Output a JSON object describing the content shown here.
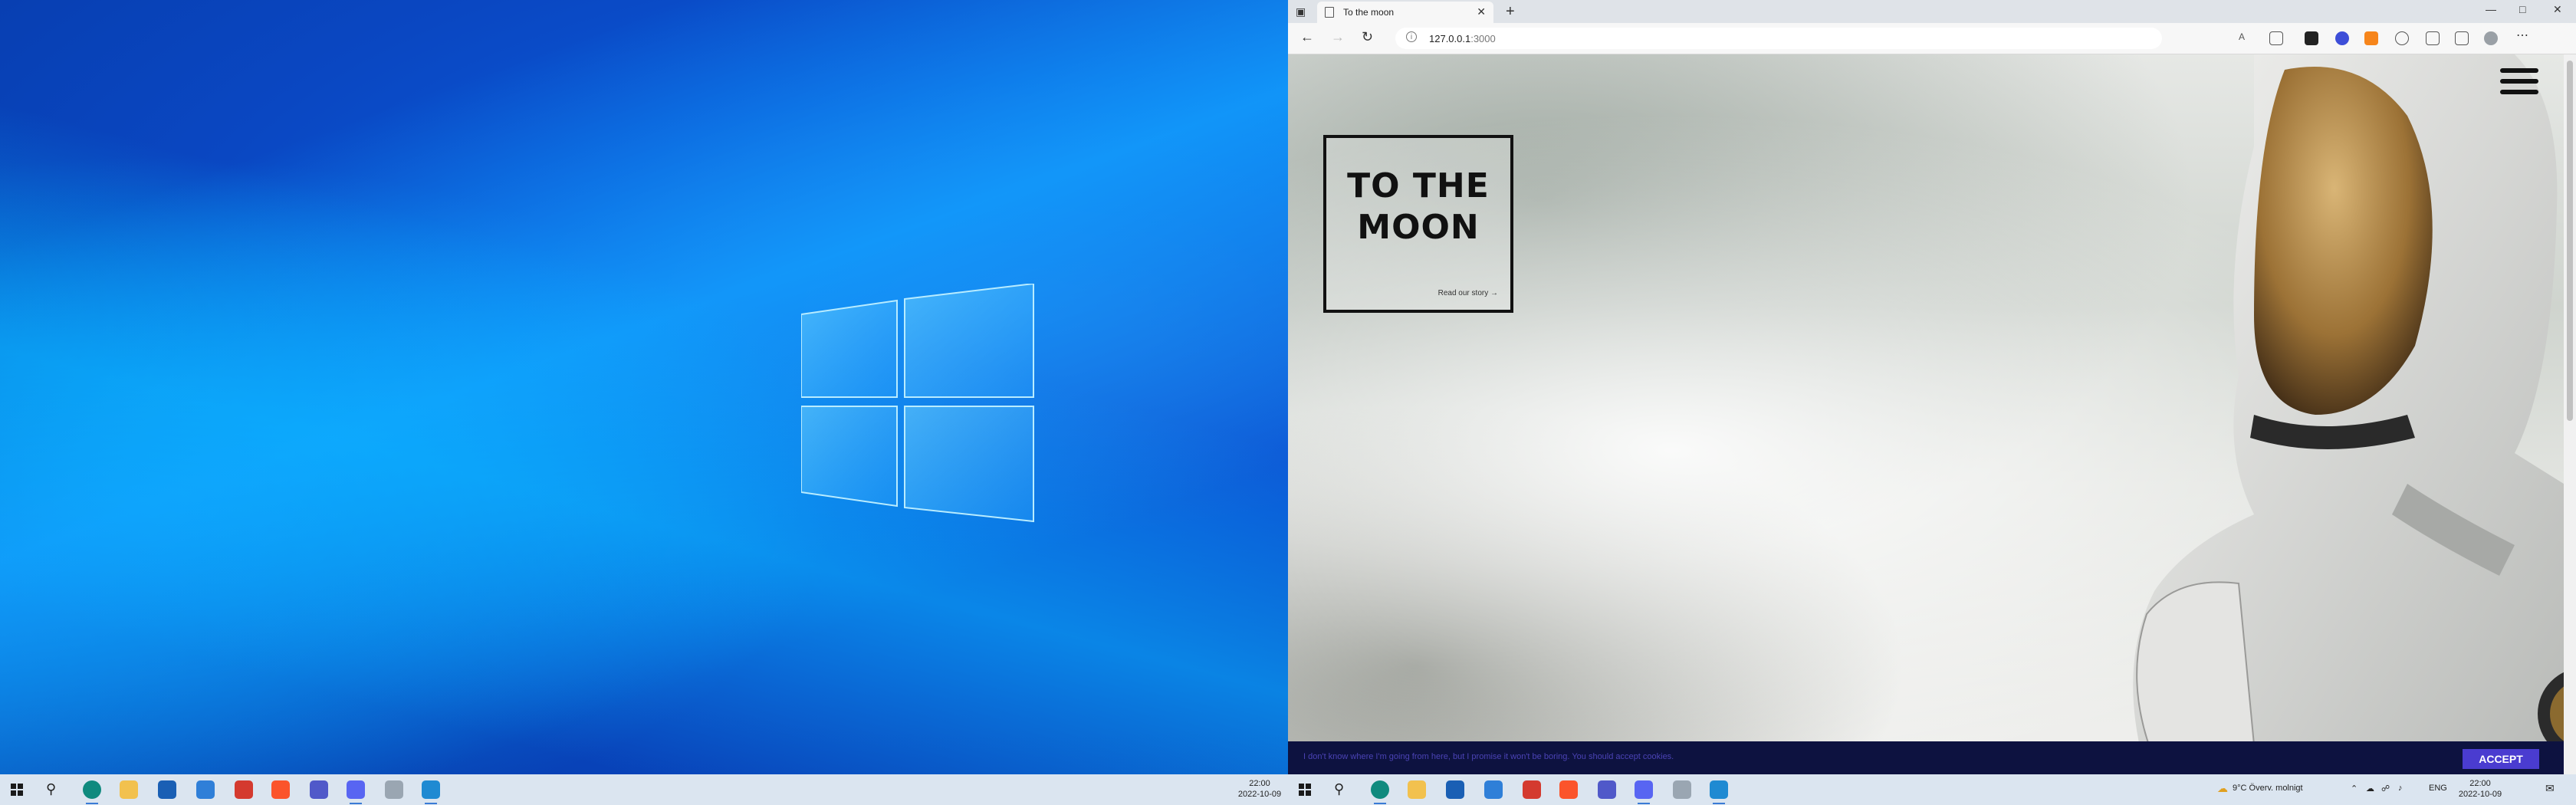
{
  "browser": {
    "tab_title": "To the moon",
    "url_host": "127.0.0.1",
    "url_port": ":3000"
  },
  "page": {
    "hero_title": "TO THE MOON",
    "story_link": "Read our story →",
    "cookie_message": "I don't know where I'm going from here, but I promise it won't be boring. You should accept cookies.",
    "accept_label": "ACCEPT"
  },
  "taskbar_left": {
    "time": "22:00",
    "date": "2022-10-09"
  },
  "taskbar_right": {
    "weather": "9°C  Överv. molnigt",
    "language": "ENG",
    "time": "22:00",
    "date": "2022-10-09"
  },
  "colors": {
    "cookie_bar": "#0d1240",
    "accept_button": "#4a3cd0",
    "wallpaper": "#0a55d4"
  }
}
